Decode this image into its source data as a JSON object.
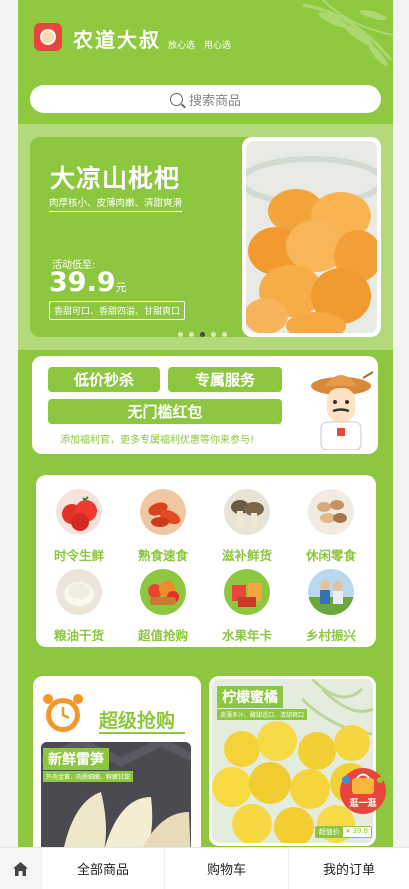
{
  "header": {
    "brand": "农道大叔",
    "slogans": [
      "放心选",
      "用心选"
    ],
    "colors": {
      "brand_green": "#8dc63f",
      "logo_red": "#e8453c"
    }
  },
  "search": {
    "placeholder": "搜索商品"
  },
  "banner": {
    "title": "大凉山枇杷",
    "subtitle": "肉厚核小、皮薄肉嫩、清甜爽滑",
    "price_label": "活动低至:",
    "price": "39.9",
    "unit": "元",
    "tags": "香甜可口、香甜四溢、甘甜爽口",
    "slide_count": 5,
    "active_slide": 3
  },
  "promo": {
    "buttons": [
      "低价秒杀",
      "专属服务",
      "无门槛红包"
    ],
    "tip": "添加福利官，更多专属福利优惠等你来参与!"
  },
  "categories": [
    {
      "label": "时令生鲜",
      "icon": "tomato-icon"
    },
    {
      "label": "熟食速食",
      "icon": "crayfish-icon"
    },
    {
      "label": "滋补鲜货",
      "icon": "mushroom-icon"
    },
    {
      "label": "休闲零食",
      "icon": "nuts-icon"
    },
    {
      "label": "粮油干货",
      "icon": "rice-icon"
    },
    {
      "label": "超值抢购",
      "icon": "fruit-basket-icon"
    },
    {
      "label": "水果年卡",
      "icon": "fruit-box-icon"
    },
    {
      "label": "乡村振兴",
      "icon": "farmers-icon"
    }
  ],
  "sections": {
    "super_deal": {
      "title": "超级抢购"
    },
    "bamboo": {
      "title": "新鲜雷笋",
      "subtitle": "外壳金黄、肉质细嫩、鲜嫩甘甜"
    },
    "lemon": {
      "title": "柠檬蜜橘",
      "subtitle": "皮薄多汁、酸甜适口、清甜爽口",
      "price_tag": "超值价",
      "price": "¥ 39.9"
    }
  },
  "float_button": {
    "label": "逛一逛"
  },
  "tabbar": {
    "items": [
      "全部商品",
      "购物车",
      "我的订单"
    ]
  }
}
